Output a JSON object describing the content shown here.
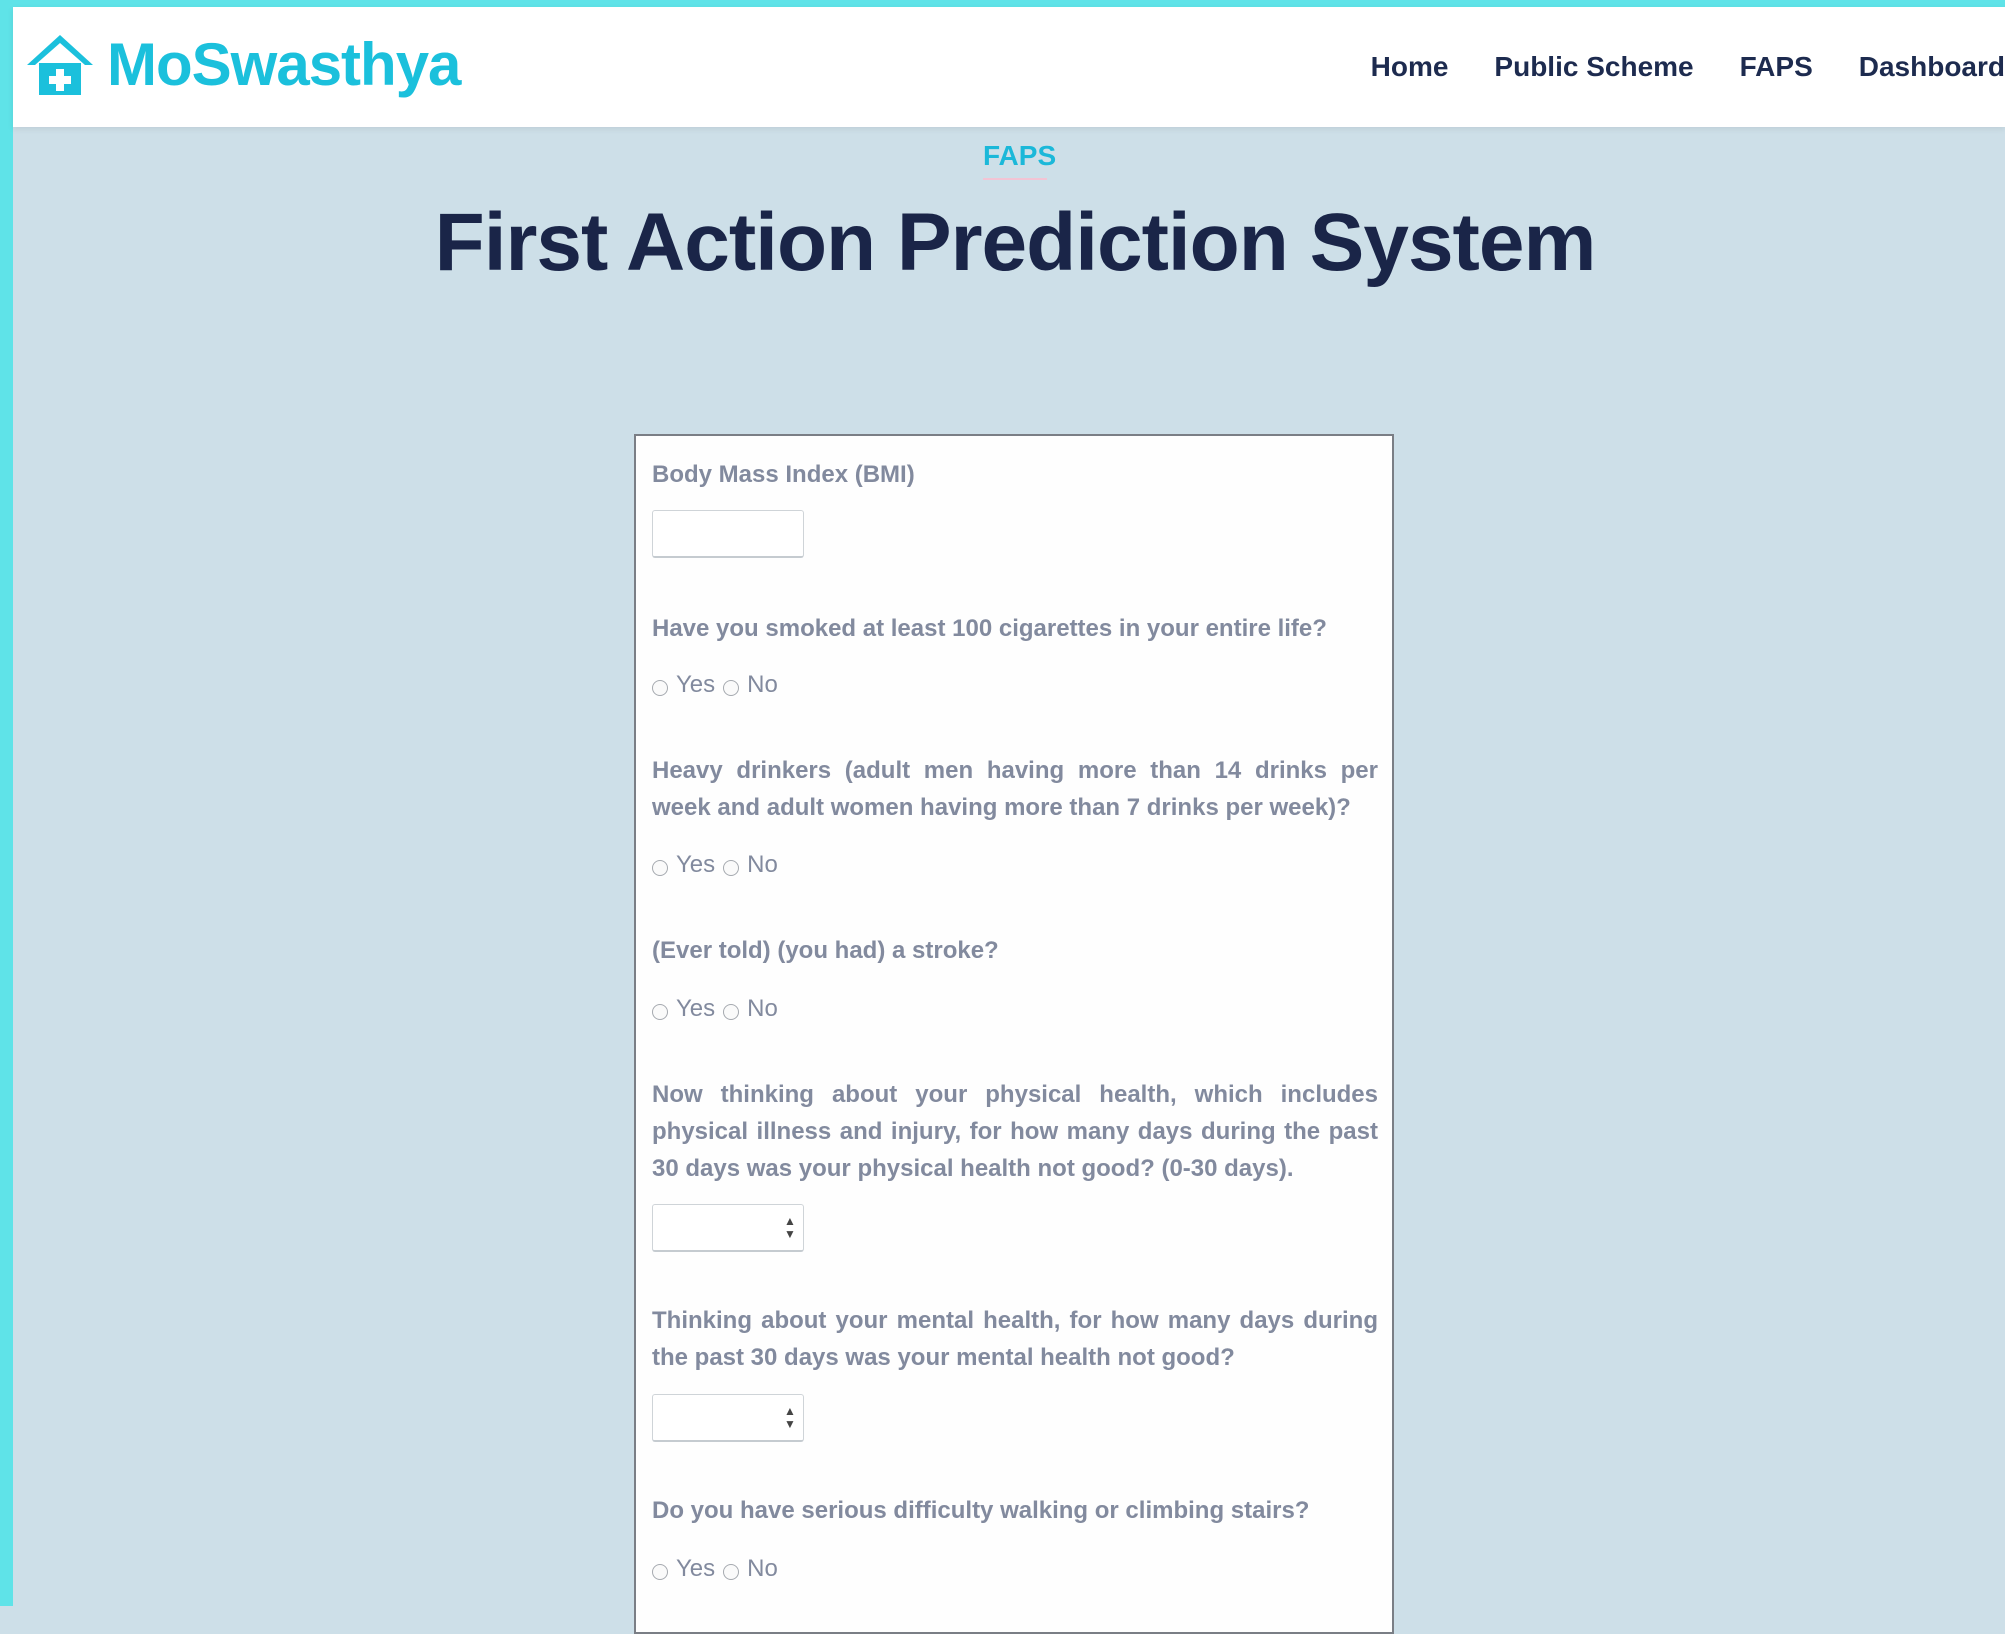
{
  "brand": {
    "name": "MoSwasthya",
    "icon": "house-medical-icon",
    "color": "#1bc0dc"
  },
  "nav": {
    "items": [
      "Home",
      "Public Scheme",
      "FAPS",
      "Dashboard"
    ]
  },
  "section": {
    "label": "FAPS",
    "title": "First Action Prediction System"
  },
  "form": {
    "bmi": {
      "label": "Body Mass Index (BMI)",
      "value": ""
    },
    "smoked": {
      "label": "Have you smoked at least 100 cigarettes in your entire life?",
      "yes": "Yes",
      "no": "No",
      "selected": null
    },
    "drinker": {
      "label": "Heavy drinkers (adult men having more than 14 drinks per week and adult women having more than 7 drinks per week)?",
      "yes": "Yes",
      "no": "No",
      "selected": null
    },
    "stroke": {
      "label": "(Ever told) (you had) a stroke?",
      "yes": "Yes",
      "no": "No",
      "selected": null
    },
    "physical_health": {
      "label": "Now thinking about your physical health, which includes physical illness and injury, for how many days during the past 30 days was your physical health not good? (0-30 days).",
      "value": ""
    },
    "mental_health": {
      "label": "Thinking about your mental health, for how many days during the past 30 days was your mental health not good?",
      "value": ""
    },
    "walking": {
      "label": "Do you have serious difficulty walking or climbing stairs?",
      "yes": "Yes",
      "no": "No",
      "selected": null
    }
  }
}
